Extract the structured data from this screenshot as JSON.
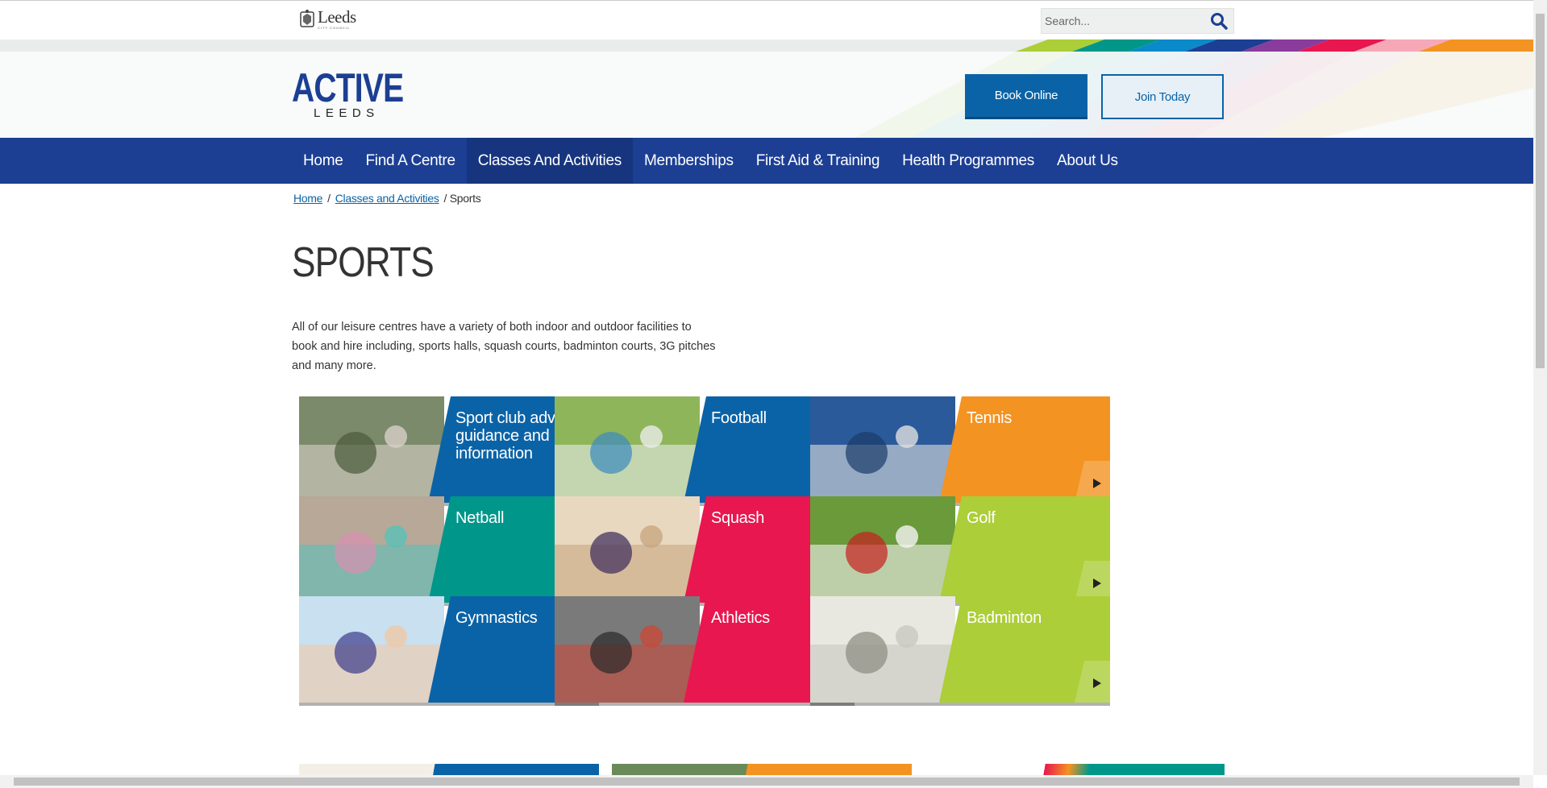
{
  "council": {
    "name": "Leeds",
    "subtitle": "CITY COUNCIL"
  },
  "search": {
    "placeholder": "Search..."
  },
  "brand": {
    "main": "ACTIVE",
    "sub": "LEEDS"
  },
  "header_buttons": {
    "book": "Book Online",
    "join": "Join Today"
  },
  "nav": {
    "items": [
      {
        "label": "Home"
      },
      {
        "label": "Find A Centre"
      },
      {
        "label": "Classes And Activities"
      },
      {
        "label": "Memberships"
      },
      {
        "label": "First Aid & Training"
      },
      {
        "label": "Health Programmes"
      },
      {
        "label": "About Us"
      }
    ]
  },
  "breadcrumb": {
    "home": "Home",
    "classes": "Classes and Activities",
    "current": "/ Sports",
    "sep": "/"
  },
  "page": {
    "title": "SPORTS",
    "intro": "All of our leisure centres have a variety of both indoor and outdoor facilities to book and hire including, sports halls, squash courts, badminton courts, 3G pitches and many more."
  },
  "tiles": [
    {
      "label": "Sport club advice guidance and information",
      "color": "#0b63a7",
      "image": "group-photo"
    },
    {
      "label": "Football",
      "color": "#0b63a7",
      "image": "goalkeeper-photo"
    },
    {
      "label": "Tennis",
      "color": "#f39322",
      "image": "tennis-racket-photo"
    },
    {
      "label": "Netball",
      "color": "#00978a",
      "image": "netball-team-photo"
    },
    {
      "label": "Squash",
      "color": "#e8174f",
      "image": "squash-court-photo"
    },
    {
      "label": "Golf",
      "color": "#acce38",
      "image": "golf-ball-photo"
    },
    {
      "label": "Gymnastics",
      "color": "#0b63a7",
      "image": "gymnast-photo"
    },
    {
      "label": "Athletics",
      "color": "#e8174f",
      "image": "runners-photo"
    },
    {
      "label": "Badminton",
      "color": "#acce38",
      "image": "shuttlecock-photo"
    }
  ],
  "colors": {
    "navy": "#1c3f94",
    "blue": "#0b63a7",
    "orange": "#f39322",
    "teal": "#00978a",
    "pink": "#e8174f",
    "lime": "#acce38"
  }
}
